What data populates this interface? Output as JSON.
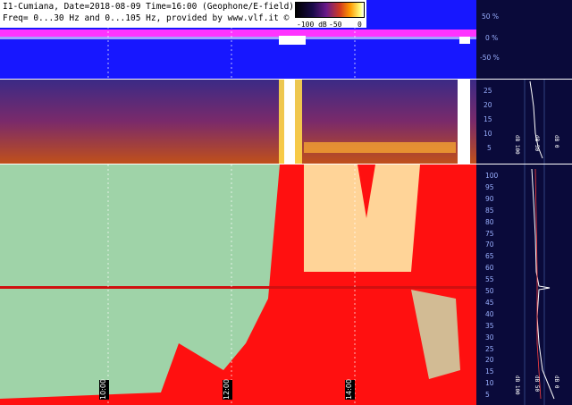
{
  "header": {
    "line1": "I1-Cumiana, Date=2018-08-09 Time=16:00 (Geophone/E-field))",
    "line2": "Freq= 0...30 Hz and 0...105 Hz, provided by www.vlf.it ©"
  },
  "colorbar": {
    "ticks": [
      "-100 dB",
      "-50",
      "0"
    ]
  },
  "top_scale": {
    "labels": [
      "50 %",
      "0 %",
      "-50 %"
    ]
  },
  "mid_scale": {
    "labels": [
      "25",
      "20",
      "15",
      "10",
      "5"
    ]
  },
  "main_scale": {
    "labels": [
      "100",
      "95",
      "90",
      "85",
      "80",
      "75",
      "70",
      "65",
      "60",
      "55",
      "50",
      "45",
      "40",
      "35",
      "30",
      "25",
      "20",
      "15",
      "10",
      "5"
    ]
  },
  "time_axis": {
    "labels": [
      "10:00",
      "12:00",
      "14:00"
    ]
  },
  "side_panels": {
    "mid_labels": [
      "dB 100",
      "dB 50",
      "dB 0"
    ],
    "main_labels": [
      "dB 100",
      "dB 50",
      "dB 0"
    ]
  },
  "colors": {
    "top_bg": "#1717ff",
    "magenta_band": "#ff33ff",
    "mid_bg": "#3b2a86",
    "main_bg": "#9fd3a8",
    "saturated": "#ff1010",
    "scale_bg": "#0a0a3a",
    "side_bg": "#0a0a3a"
  }
}
